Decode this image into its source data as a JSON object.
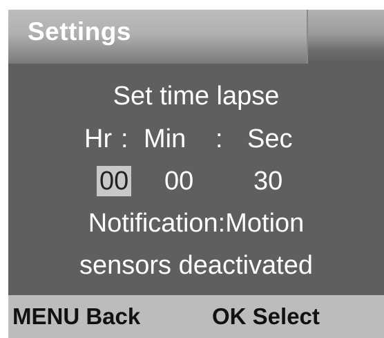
{
  "header": {
    "title": "Settings"
  },
  "dialog": {
    "title": "Set time lapse",
    "units": {
      "hr": "Hr",
      "sep1": ":",
      "min": "Min",
      "sep2": ":",
      "sec": "Sec"
    },
    "values": {
      "hr": "00",
      "min": "00",
      "sec": "30"
    },
    "selected_field": "hr",
    "notification_line1": "Notification:Motion",
    "notification_line2": "sensors deactivated"
  },
  "footer": {
    "menu_back": "MENU Back",
    "ok_select": "OK Select"
  },
  "colors": {
    "screen_bg": "#5f5f5f",
    "text": "#ffffff",
    "selection_bg": "#c8c8c8",
    "footer_bg": "#bcbcbc"
  }
}
